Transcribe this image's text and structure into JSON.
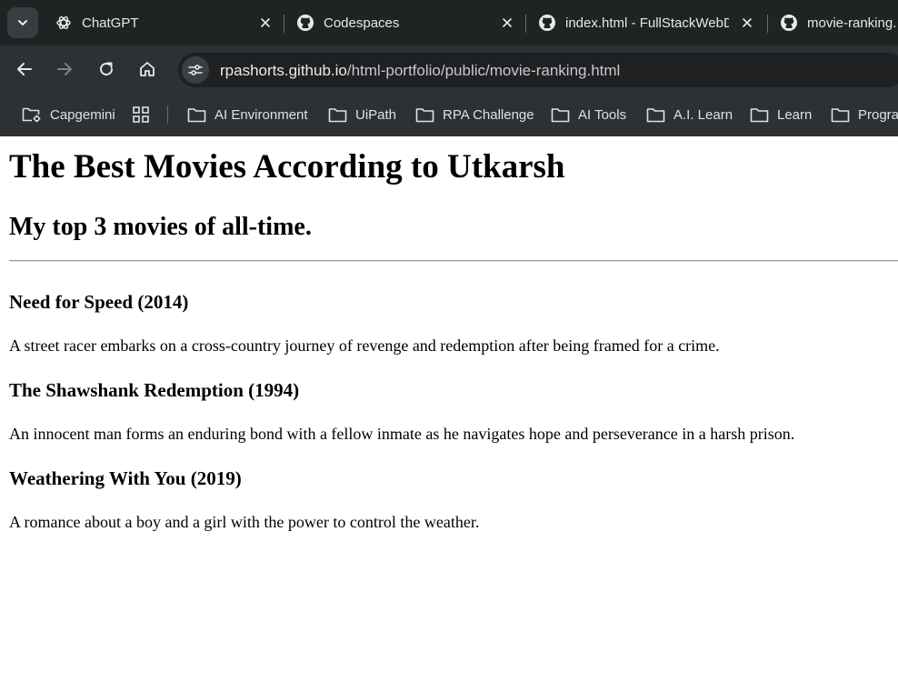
{
  "tabs": [
    {
      "title": "ChatGPT"
    },
    {
      "title": "Codespaces"
    },
    {
      "title": "index.html - FullStackWebD"
    },
    {
      "title": "movie-ranking."
    }
  ],
  "address_bar": {
    "domain": "rpashorts.github.io",
    "path": "/html-portfolio/public/movie-ranking.html"
  },
  "bookmarks": [
    {
      "label": "Capgemini"
    },
    {
      "label": "AI Environment"
    },
    {
      "label": "UiPath"
    },
    {
      "label": "RPA Challenge"
    },
    {
      "label": "AI Tools"
    },
    {
      "label": "A.I. Learn"
    },
    {
      "label": "Learn"
    },
    {
      "label": "Progra"
    }
  ],
  "page": {
    "title": "The Best Movies According to Utkarsh",
    "subtitle": "My top 3 movies of all-time.",
    "movies": [
      {
        "title": "Need for Speed (2014)",
        "description": "A street racer embarks on a cross-country journey of revenge and redemption after being framed for a crime."
      },
      {
        "title": "The Shawshank Redemption (1994)",
        "description": "An innocent man forms an enduring bond with a fellow inmate as he navigates hope and perseverance in a harsh prison."
      },
      {
        "title": "Weathering With You (2019)",
        "description": "A romance about a boy and a girl with the power to control the weather."
      }
    ]
  },
  "colors": {
    "tabstrip_bg": "#202324",
    "toolbar_bg": "#2e3134",
    "omnibox_bg": "#1e2022",
    "page_bg": "#ffffff"
  }
}
